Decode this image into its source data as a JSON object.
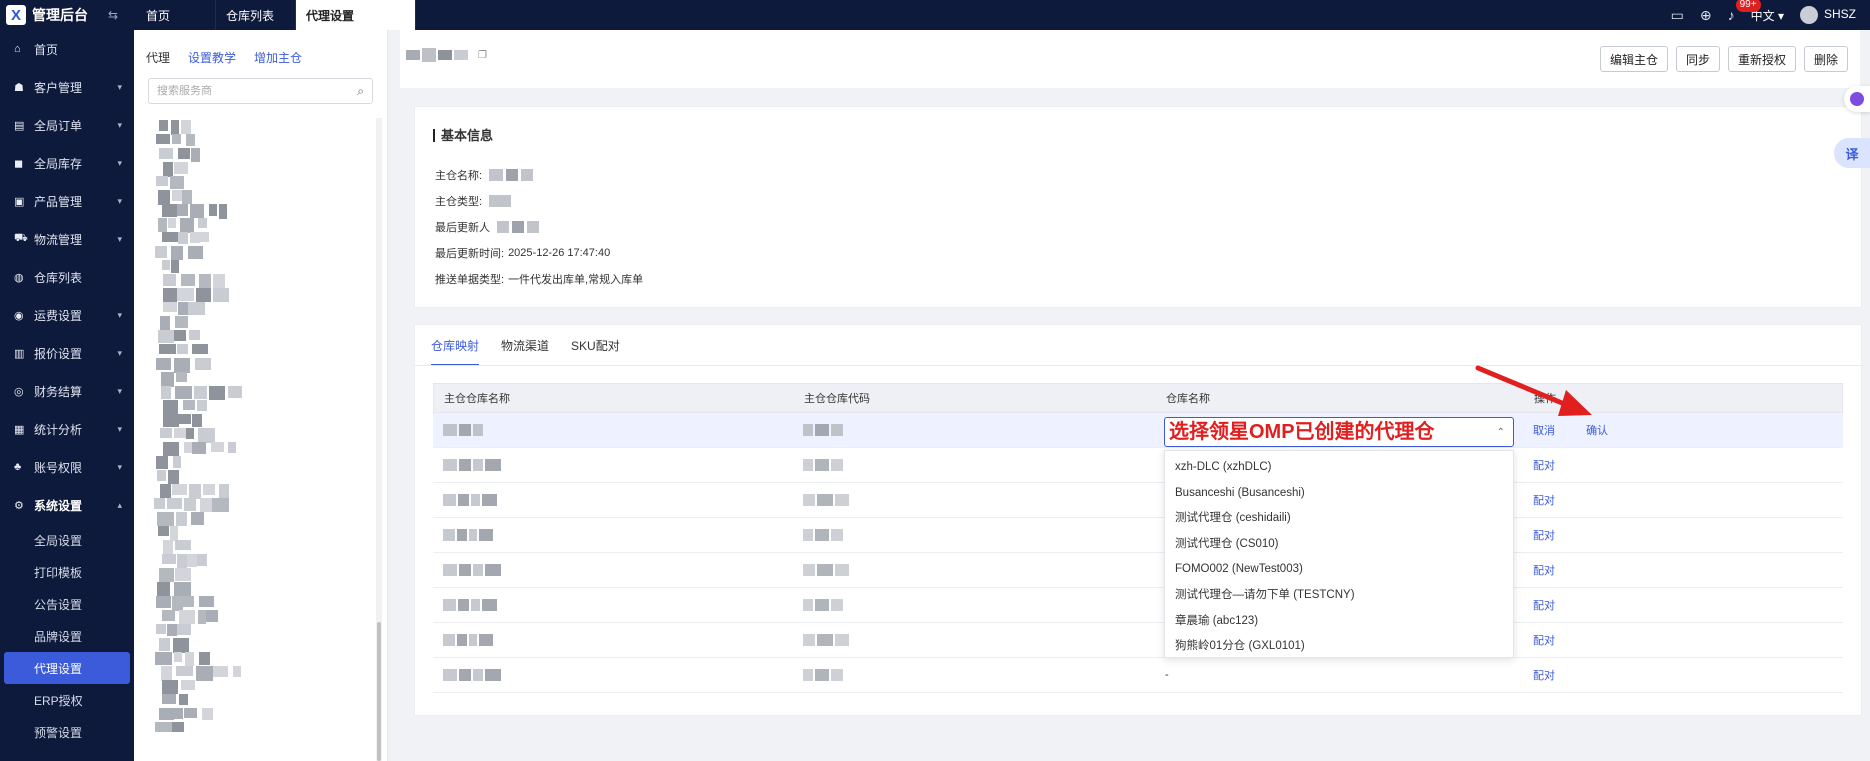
{
  "app": {
    "title": "管理后台"
  },
  "tabs": [
    {
      "label": "首页",
      "active": false
    },
    {
      "label": "仓库列表",
      "active": false
    },
    {
      "label": "代理设置",
      "active": true
    }
  ],
  "topbar": {
    "notification_count": "99+",
    "language": "中文",
    "user": "SHSZ"
  },
  "sidebar": {
    "items": [
      {
        "label": "首页",
        "icon": "home-icon",
        "expandable": false
      },
      {
        "label": "客户管理",
        "icon": "customer-icon",
        "expandable": true
      },
      {
        "label": "全局订单",
        "icon": "order-icon",
        "expandable": true
      },
      {
        "label": "全局库存",
        "icon": "inventory-icon",
        "expandable": true
      },
      {
        "label": "产品管理",
        "icon": "product-icon",
        "expandable": true
      },
      {
        "label": "物流管理",
        "icon": "truck-icon",
        "expandable": true
      },
      {
        "label": "仓库列表",
        "icon": "warehouse-icon",
        "expandable": false
      },
      {
        "label": "运费设置",
        "icon": "freight-icon",
        "expandable": true
      },
      {
        "label": "报价设置",
        "icon": "quote-icon",
        "expandable": true
      },
      {
        "label": "财务结算",
        "icon": "finance-icon",
        "expandable": true
      },
      {
        "label": "统计分析",
        "icon": "stats-icon",
        "expandable": true
      },
      {
        "label": "账号权限",
        "icon": "account-icon",
        "expandable": true
      },
      {
        "label": "系统设置",
        "icon": "settings-icon",
        "expandable": true,
        "open": true
      }
    ],
    "sub_items": [
      {
        "label": "全局设置",
        "active": false
      },
      {
        "label": "打印模板",
        "active": false
      },
      {
        "label": "公告设置",
        "active": false
      },
      {
        "label": "品牌设置",
        "active": false
      },
      {
        "label": "代理设置",
        "active": true
      },
      {
        "label": "ERP授权",
        "active": false
      },
      {
        "label": "预警设置",
        "active": false
      }
    ]
  },
  "tree_panel": {
    "title": "代理",
    "link_tutorial": "设置教学",
    "link_add": "增加主仓",
    "search_placeholder": "搜索服务商"
  },
  "header_buttons": {
    "edit": "编辑主仓",
    "sync": "同步",
    "reauth": "重新授权",
    "delete": "删除"
  },
  "basic_info": {
    "title": "基本信息",
    "main_warehouse_name_label": "主仓名称:",
    "main_warehouse_type_label": "主仓类型:",
    "last_updater_label": "最后更新人",
    "last_update_time_label": "最后更新时间:",
    "last_update_time": "2025-12-26 17:47:40",
    "push_doc_type_label": "推送单据类型:",
    "push_doc_type": "一件代发出库单,常规入库单"
  },
  "mapping": {
    "tabs": [
      {
        "label": "仓库映射",
        "active": true
      },
      {
        "label": "物流渠道",
        "active": false
      },
      {
        "label": "SKU配对",
        "active": false
      }
    ],
    "columns": [
      "主仓仓库名称",
      "主仓仓库代码",
      "仓库名称",
      "操作"
    ],
    "first_row": {
      "select_value": "选择领星OMP已创建的代理仓",
      "cancel": "取消",
      "confirm": "确认"
    },
    "row_action": "配对",
    "last_row_warehouse": "-",
    "row_count_after_first": 7,
    "options": [
      "xzh-DLC (xzhDLC)",
      "Busanceshi (Busanceshi)",
      "测试代理仓 (ceshidaili)",
      "测试代理仓 (CS010)",
      "FOMO002 (NewTest003)",
      "测试代理仓—请勿下单 (TESTCNY)",
      "章晨瑜 (abc123)",
      "狗熊岭01分仓 (GXL0101)"
    ]
  },
  "colors": {
    "brand": "#0e1a3c",
    "accent": "#3b5bdb",
    "annotation": "#e01f1f"
  }
}
